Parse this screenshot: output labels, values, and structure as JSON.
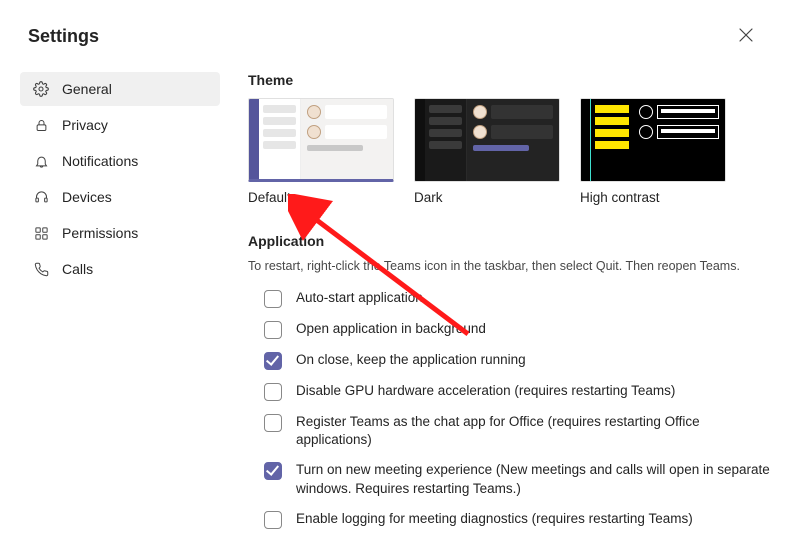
{
  "header": {
    "title": "Settings"
  },
  "sidebar": {
    "items": [
      {
        "label": "General",
        "icon": "gear-icon",
        "active": true
      },
      {
        "label": "Privacy",
        "icon": "lock-icon",
        "active": false
      },
      {
        "label": "Notifications",
        "icon": "bell-icon",
        "active": false
      },
      {
        "label": "Devices",
        "icon": "headset-icon",
        "active": false
      },
      {
        "label": "Permissions",
        "icon": "app-icon",
        "active": false
      },
      {
        "label": "Calls",
        "icon": "phone-icon",
        "active": false
      }
    ]
  },
  "theme": {
    "title": "Theme",
    "options": [
      {
        "label": "Default",
        "selected": true
      },
      {
        "label": "Dark",
        "selected": false
      },
      {
        "label": "High contrast",
        "selected": false
      }
    ]
  },
  "application": {
    "title": "Application",
    "subtitle": "To restart, right-click the Teams icon in the taskbar, then select Quit. Then reopen Teams.",
    "options": [
      {
        "label": "Auto-start application",
        "checked": false
      },
      {
        "label": "Open application in background",
        "checked": false
      },
      {
        "label": "On close, keep the application running",
        "checked": true
      },
      {
        "label": "Disable GPU hardware acceleration (requires restarting Teams)",
        "checked": false
      },
      {
        "label": "Register Teams as the chat app for Office (requires restarting Office applications)",
        "checked": false
      },
      {
        "label": "Turn on new meeting experience (New meetings and calls will open in separate windows. Requires restarting Teams.)",
        "checked": true
      },
      {
        "label": "Enable logging for meeting diagnostics (requires restarting Teams)",
        "checked": false
      }
    ]
  }
}
